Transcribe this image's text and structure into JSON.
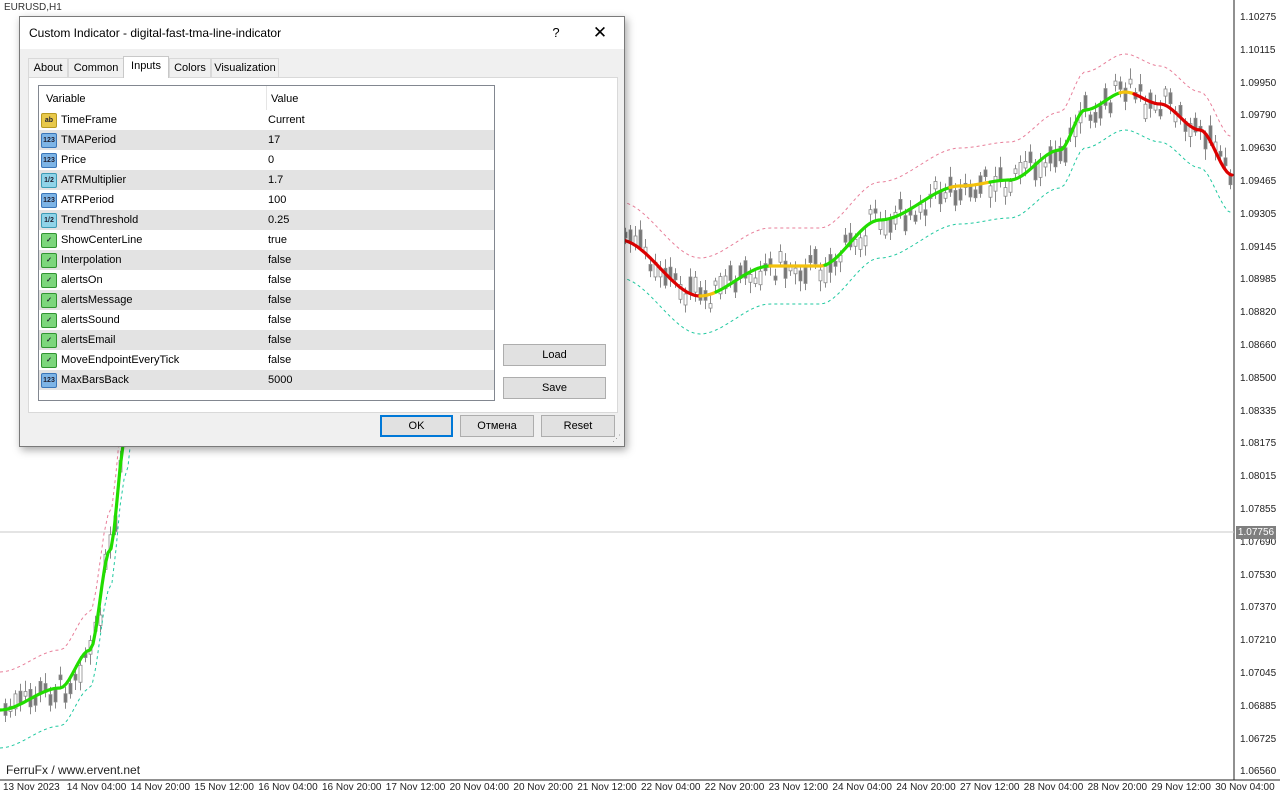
{
  "chart": {
    "symbol": "EURUSD,H1",
    "watermark": "FerruFx / www.ervent.net",
    "current_price": "1.07756",
    "price_scale": [
      "1.10275",
      "1.10115",
      "1.09950",
      "1.09790",
      "1.09630",
      "1.09465",
      "1.09305",
      "1.09145",
      "1.08985",
      "1.08820",
      "1.08660",
      "1.08500",
      "1.08335",
      "1.08175",
      "1.08015",
      "1.07855",
      "1.07690",
      "1.07530",
      "1.07370",
      "1.07210",
      "1.07045",
      "1.06885",
      "1.06725",
      "1.06560"
    ],
    "time_scale": [
      "13 Nov 2023",
      "14 Nov 04:00",
      "14 Nov 20:00",
      "15 Nov 12:00",
      "16 Nov 04:00",
      "16 Nov 20:00",
      "17 Nov 12:00",
      "20 Nov 04:00",
      "20 Nov 20:00",
      "21 Nov 12:00",
      "22 Nov 04:00",
      "22 Nov 20:00",
      "23 Nov 12:00",
      "24 Nov 04:00",
      "24 Nov 20:00",
      "27 Nov 12:00",
      "28 Nov 04:00",
      "28 Nov 20:00",
      "29 Nov 12:00",
      "30 Nov 04:00"
    ],
    "colors": {
      "uptrend": "#22dd00",
      "downtrend": "#dd0000",
      "neutral": "#f4c20d",
      "upper_band": "#e87f9a",
      "lower_band": "#20c9a0",
      "candle_bull": "#ffffff",
      "candle_bear": "#777777"
    }
  },
  "dialog": {
    "title": "Custom Indicator - digital-fast-tma-line-indicator",
    "help_label": "?",
    "close_label": "✕",
    "tabs": [
      {
        "label": "About",
        "active": false
      },
      {
        "label": "Common",
        "active": false
      },
      {
        "label": "Inputs",
        "active": true
      },
      {
        "label": "Colors",
        "active": false
      },
      {
        "label": "Visualization",
        "active": false
      }
    ],
    "columns": {
      "variable": "Variable",
      "value": "Value"
    },
    "inputs": [
      {
        "icon": "string-type-icon",
        "icon_text": "ab",
        "name": "TimeFrame",
        "value": "Current"
      },
      {
        "icon": "integer-type-icon",
        "icon_text": "123",
        "name": "TMAPeriod",
        "value": "17"
      },
      {
        "icon": "integer-type-icon",
        "icon_text": "123",
        "name": "Price",
        "value": "0"
      },
      {
        "icon": "double-type-icon",
        "icon_text": "1/2",
        "name": "ATRMultiplier",
        "value": "1.7"
      },
      {
        "icon": "integer-type-icon",
        "icon_text": "123",
        "name": "ATRPeriod",
        "value": "100"
      },
      {
        "icon": "double-type-icon",
        "icon_text": "1/2",
        "name": "TrendThreshold",
        "value": "0.25"
      },
      {
        "icon": "bool-type-icon",
        "icon_text": "✓",
        "name": "ShowCenterLine",
        "value": "true"
      },
      {
        "icon": "bool-type-icon",
        "icon_text": "✓",
        "name": "Interpolation",
        "value": "false"
      },
      {
        "icon": "bool-type-icon",
        "icon_text": "✓",
        "name": "alertsOn",
        "value": "false"
      },
      {
        "icon": "bool-type-icon",
        "icon_text": "✓",
        "name": "alertsMessage",
        "value": "false"
      },
      {
        "icon": "bool-type-icon",
        "icon_text": "✓",
        "name": "alertsSound",
        "value": "false"
      },
      {
        "icon": "bool-type-icon",
        "icon_text": "✓",
        "name": "alertsEmail",
        "value": "false"
      },
      {
        "icon": "bool-type-icon",
        "icon_text": "✓",
        "name": "MoveEndpointEveryTick",
        "value": "false"
      },
      {
        "icon": "integer-type-icon",
        "icon_text": "123",
        "name": "MaxBarsBack",
        "value": "5000"
      }
    ],
    "load_label": "Load",
    "save_label": "Save",
    "ok_label": "OK",
    "cancel_label": "Отмена",
    "reset_label": "Reset"
  }
}
